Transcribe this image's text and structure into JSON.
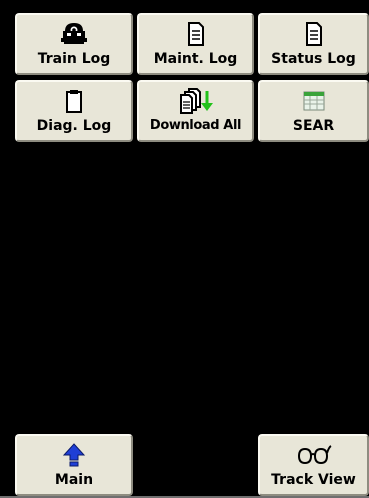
{
  "buttons": {
    "train_log": {
      "label": "Train Log",
      "icon": "locomotive-icon"
    },
    "maint_log": {
      "label": "Maint. Log",
      "icon": "document-icon"
    },
    "status_log": {
      "label": "Status Log",
      "icon": "document-icon"
    },
    "diag_log": {
      "label": "Diag. Log",
      "icon": "clipboard-icon"
    },
    "download_all": {
      "label": "Download All",
      "icon": "download-documents-icon"
    },
    "sear": {
      "label": "SEAR",
      "icon": "spreadsheet-icon"
    },
    "main": {
      "label": "Main",
      "icon": "up-arrow-icon"
    },
    "track_view": {
      "label": "Track View",
      "icon": "eyeglasses-icon"
    }
  },
  "colors": {
    "background": "#000000",
    "button_face": "#e8e6d8",
    "arrow_blue": "#1f3fd6",
    "download_green": "#22c21a",
    "sheet_green": "#3aa33a"
  }
}
